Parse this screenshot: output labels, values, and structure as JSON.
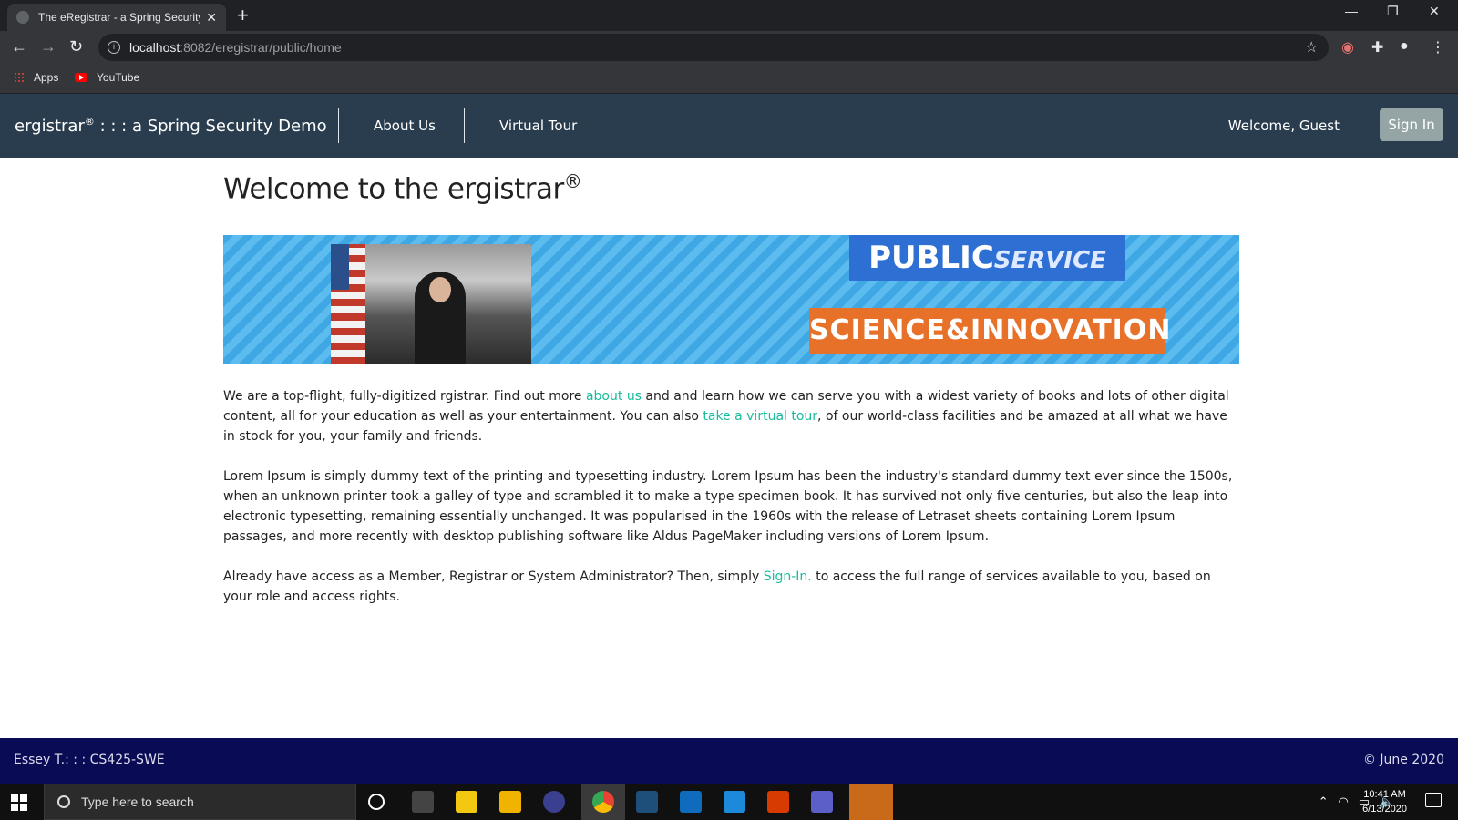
{
  "browser": {
    "tab_title": "The eRegistrar - a Spring Security",
    "new_tab": "+",
    "url_host": "localhost",
    "url_path": ":8082/eregistrar/public/home",
    "bookmarks": [
      {
        "label": "Apps",
        "icon": "apps-grid-icon"
      },
      {
        "label": "YouTube",
        "icon": "youtube-icon"
      }
    ]
  },
  "nav": {
    "brand": "ergistrar",
    "brand_mark": "®",
    "brand_suffix": " : : : a Spring Security Demo",
    "links": [
      "About Us",
      "Virtual Tour"
    ],
    "welcome": "Welcome, Guest",
    "signin": "Sign In"
  },
  "page": {
    "heading": "Welcome to the ergistrar",
    "heading_mark": "®",
    "banner": {
      "public": "PUBLIC",
      "service": "SERVICE",
      "science": "SCIENCE&INNOVATION"
    },
    "p1_a": "We are a top-flight, fully-digitized rgistrar. Find out more ",
    "p1_link1": "about us",
    "p1_b": " and and learn how we can serve you with a widest variety of books and lots of other digital content, all for your education as well as your entertainment. You can also ",
    "p1_link2": "take a virtual tour",
    "p1_c": ", of our world-class facilities and be amazed at all what we have in stock for you, your family and friends.",
    "p2": "Lorem Ipsum is simply dummy text of the printing and typesetting industry. Lorem Ipsum has been the industry's standard dummy text ever since the 1500s, when an unknown printer took a galley of type and scrambled it to make a type specimen book. It has survived not only five centuries, but also the leap into electronic typesetting, remaining essentially unchanged. It was popularised in the 1960s with the release of Letraset sheets containing Lorem Ipsum passages, and more recently with desktop publishing software like Aldus PageMaker including versions of Lorem Ipsum.",
    "p3_a": "Already have access as a Member, Registrar or System Administrator? Then, simply ",
    "p3_link": "Sign-In.",
    "p3_b": " to access the full range of services available to you, based on your role and access rights."
  },
  "footer": {
    "left": "Essey T.: : : CS425-SWE",
    "right": "© June 2020"
  },
  "taskbar": {
    "search_placeholder": "Type here to search",
    "time": "10:41 AM",
    "date": "6/13/2020"
  },
  "colors": {
    "nav_bg": "#2a3d4f",
    "link": "#18bc9c",
    "footer_bg": "#0a0b55",
    "signin_bg": "#95a5a6"
  }
}
